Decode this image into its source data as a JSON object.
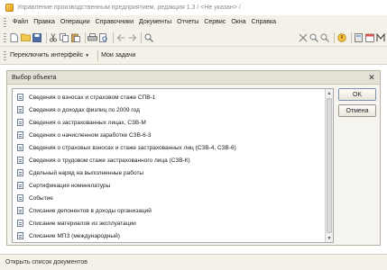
{
  "window": {
    "title": "Управление производственным предприятием, редакция 1.3 / <Не указан> /"
  },
  "menu": {
    "items": [
      "Файл",
      "Правка",
      "Операции",
      "Справочники",
      "Документы",
      "Отчеты",
      "Сервис",
      "Окна",
      "Справка"
    ]
  },
  "toolbar": {
    "buttons": [
      "new-icon",
      "open-icon",
      "save-icon",
      "cut-icon",
      "copy-icon",
      "paste-icon",
      "print-icon",
      "preview-icon",
      "back-icon",
      "forward-icon",
      "search-icon",
      "find-next-icon",
      "find-prev-icon",
      "help-icon",
      "calculator-icon",
      "calendar-icon",
      "m-icon"
    ]
  },
  "panel": {
    "switch_interface": "Переключить интерфейс",
    "my_tasks": "Мои задачи"
  },
  "dialog": {
    "title": "Выбор объекта",
    "close_glyph": "✕",
    "ok_label": "OK",
    "cancel_label": "Отмена",
    "items": [
      "Сведения о взносах и страховом стаже СПВ-1",
      "Сведения о доходах физлиц по 2009 год",
      "Сведения о застрахованных лицах, СЗВ-М",
      "Сведения о начисленном заработке СЗВ-6-3",
      "Сведения о страховых взносах и стаже застрахованных лиц (СЗВ-4, СЗВ-6)",
      "Сведения о трудовом стаже застрахованного лица (СЗВ-К)",
      "Сдельный наряд на выполненные работы",
      "Сертификация номенклатуры",
      "Событие",
      "Списание депонентов в доходы организаций",
      "Списание материалов из эксплуатации",
      "Списание МПЗ (международный)"
    ]
  },
  "status": {
    "text": "Открыть список документов"
  },
  "colors": {
    "chrome": "#f4f1e8",
    "dialog_bg": "#f6f4ee",
    "dialog_header": "#e4e1d6",
    "title_text": "#8a8a8a"
  }
}
